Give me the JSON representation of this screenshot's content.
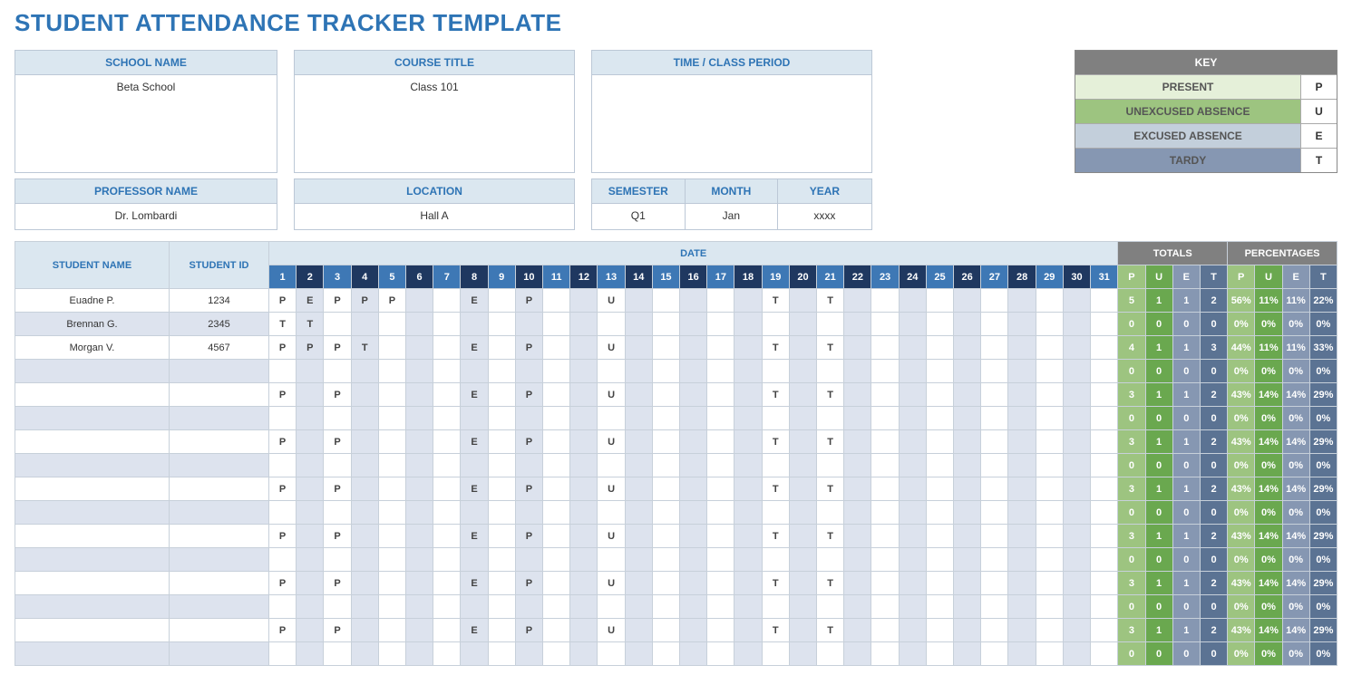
{
  "title": "STUDENT ATTENDANCE TRACKER TEMPLATE",
  "info": {
    "school_name_label": "SCHOOL NAME",
    "school_name_value": "Beta School",
    "course_title_label": "COURSE TITLE",
    "course_title_value": "Class 101",
    "time_period_label": "TIME / CLASS PERIOD",
    "time_period_value": "",
    "professor_label": "PROFESSOR NAME",
    "professor_value": "Dr. Lombardi",
    "location_label": "LOCATION",
    "location_value": "Hall A",
    "semester_label": "SEMESTER",
    "semester_value": "Q1",
    "month_label": "MONTH",
    "month_value": "Jan",
    "year_label": "YEAR",
    "year_value": "xxxx"
  },
  "key": {
    "header": "KEY",
    "rows": [
      {
        "name": "PRESENT",
        "code": "P",
        "cls": "kp"
      },
      {
        "name": "UNEXCUSED ABSENCE",
        "code": "U",
        "cls": "ku"
      },
      {
        "name": "EXCUSED ABSENCE",
        "code": "E",
        "cls": "ke"
      },
      {
        "name": "TARDY",
        "code": "T",
        "cls": "kt"
      }
    ]
  },
  "table": {
    "hdr_student": "STUDENT NAME",
    "hdr_id": "STUDENT ID",
    "hdr_date": "DATE",
    "hdr_totals": "TOTALS",
    "hdr_pct": "PERCENTAGES",
    "days": 31,
    "tot_cols": [
      "P",
      "U",
      "E",
      "T"
    ],
    "pct_cols": [
      "P",
      "U",
      "E",
      "T"
    ],
    "rows": [
      {
        "name": "Euadne P.",
        "id": "1234",
        "cells": {
          "1": "P",
          "2": "E",
          "3": "P",
          "4": "P",
          "5": "P",
          "8": "E",
          "10": "P",
          "13": "U",
          "19": "T",
          "21": "T"
        },
        "tot": [
          "5",
          "1",
          "1",
          "2"
        ],
        "pct": [
          "56%",
          "11%",
          "11%",
          "22%"
        ]
      },
      {
        "name": "Brennan G.",
        "id": "2345",
        "cells": {
          "1": "T",
          "2": "T"
        },
        "tot": [
          "0",
          "0",
          "0",
          "0"
        ],
        "pct": [
          "0%",
          "0%",
          "0%",
          "0%"
        ]
      },
      {
        "name": "Morgan V.",
        "id": "4567",
        "cells": {
          "1": "P",
          "2": "P",
          "3": "P",
          "4": "T",
          "8": "E",
          "10": "P",
          "13": "U",
          "19": "T",
          "21": "T"
        },
        "tot": [
          "4",
          "1",
          "1",
          "3"
        ],
        "pct": [
          "44%",
          "11%",
          "11%",
          "33%"
        ]
      },
      {
        "name": "",
        "id": "",
        "cells": {},
        "tot": [
          "0",
          "0",
          "0",
          "0"
        ],
        "pct": [
          "0%",
          "0%",
          "0%",
          "0%"
        ]
      },
      {
        "name": "",
        "id": "",
        "cells": {
          "1": "P",
          "3": "P",
          "8": "E",
          "10": "P",
          "13": "U",
          "19": "T",
          "21": "T"
        },
        "tot": [
          "3",
          "1",
          "1",
          "2"
        ],
        "pct": [
          "43%",
          "14%",
          "14%",
          "29%"
        ]
      },
      {
        "name": "",
        "id": "",
        "cells": {},
        "tot": [
          "0",
          "0",
          "0",
          "0"
        ],
        "pct": [
          "0%",
          "0%",
          "0%",
          "0%"
        ]
      },
      {
        "name": "",
        "id": "",
        "cells": {
          "1": "P",
          "3": "P",
          "8": "E",
          "10": "P",
          "13": "U",
          "19": "T",
          "21": "T"
        },
        "tot": [
          "3",
          "1",
          "1",
          "2"
        ],
        "pct": [
          "43%",
          "14%",
          "14%",
          "29%"
        ]
      },
      {
        "name": "",
        "id": "",
        "cells": {},
        "tot": [
          "0",
          "0",
          "0",
          "0"
        ],
        "pct": [
          "0%",
          "0%",
          "0%",
          "0%"
        ]
      },
      {
        "name": "",
        "id": "",
        "cells": {
          "1": "P",
          "3": "P",
          "8": "E",
          "10": "P",
          "13": "U",
          "19": "T",
          "21": "T"
        },
        "tot": [
          "3",
          "1",
          "1",
          "2"
        ],
        "pct": [
          "43%",
          "14%",
          "14%",
          "29%"
        ]
      },
      {
        "name": "",
        "id": "",
        "cells": {},
        "tot": [
          "0",
          "0",
          "0",
          "0"
        ],
        "pct": [
          "0%",
          "0%",
          "0%",
          "0%"
        ]
      },
      {
        "name": "",
        "id": "",
        "cells": {
          "1": "P",
          "3": "P",
          "8": "E",
          "10": "P",
          "13": "U",
          "19": "T",
          "21": "T"
        },
        "tot": [
          "3",
          "1",
          "1",
          "2"
        ],
        "pct": [
          "43%",
          "14%",
          "14%",
          "29%"
        ]
      },
      {
        "name": "",
        "id": "",
        "cells": {},
        "tot": [
          "0",
          "0",
          "0",
          "0"
        ],
        "pct": [
          "0%",
          "0%",
          "0%",
          "0%"
        ]
      },
      {
        "name": "",
        "id": "",
        "cells": {
          "1": "P",
          "3": "P",
          "8": "E",
          "10": "P",
          "13": "U",
          "19": "T",
          "21": "T"
        },
        "tot": [
          "3",
          "1",
          "1",
          "2"
        ],
        "pct": [
          "43%",
          "14%",
          "14%",
          "29%"
        ]
      },
      {
        "name": "",
        "id": "",
        "cells": {},
        "tot": [
          "0",
          "0",
          "0",
          "0"
        ],
        "pct": [
          "0%",
          "0%",
          "0%",
          "0%"
        ]
      },
      {
        "name": "",
        "id": "",
        "cells": {
          "1": "P",
          "3": "P",
          "8": "E",
          "10": "P",
          "13": "U",
          "19": "T",
          "21": "T"
        },
        "tot": [
          "3",
          "1",
          "1",
          "2"
        ],
        "pct": [
          "43%",
          "14%",
          "14%",
          "29%"
        ]
      },
      {
        "name": "",
        "id": "",
        "cells": {},
        "tot": [
          "0",
          "0",
          "0",
          "0"
        ],
        "pct": [
          "0%",
          "0%",
          "0%",
          "0%"
        ]
      }
    ]
  }
}
